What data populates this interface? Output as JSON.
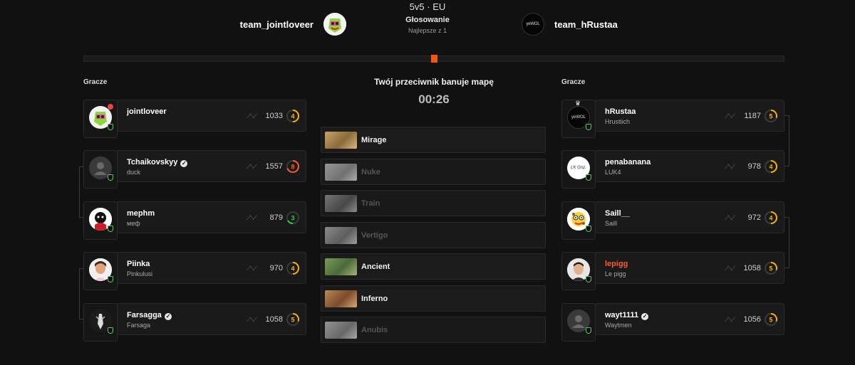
{
  "header": {
    "mode": "5v5 · EU",
    "status": "Głosowanie",
    "format": "Najlepsze z 1",
    "team_left": "team_jointloveer",
    "team_right": "team_hRustaa",
    "team_right_logo_text": "yeWOL",
    "vote_progress_pct": 50
  },
  "left": {
    "label": "Gracze",
    "players": [
      {
        "name": "jointloveer",
        "sub": "",
        "elo": "1033",
        "level": "4",
        "level_color": "#f5b400",
        "verified": false
      },
      {
        "name": "Tchaikovskyy",
        "sub": "duck",
        "elo": "1557",
        "level": "8",
        "level_color": "#ff5a2a",
        "verified": true
      },
      {
        "name": "mephm",
        "sub": "меф",
        "elo": "879",
        "level": "3",
        "level_color": "#2ecc40",
        "verified": false
      },
      {
        "name": "Piinka",
        "sub": "Pinkulusi",
        "elo": "970",
        "level": "4",
        "level_color": "#f5b400",
        "verified": false
      },
      {
        "name": "Farsagga",
        "sub": "Farsaga",
        "elo": "1058",
        "level": "5",
        "level_color": "#f5b400",
        "verified": true
      }
    ]
  },
  "right": {
    "label": "Gracze",
    "players": [
      {
        "name": "hRustaa",
        "sub": "Hrustiich",
        "elo": "1187",
        "level": "5",
        "level_color": "#f5b400",
        "verified": false,
        "avatar_text": "yeWOL"
      },
      {
        "name": "penabanana",
        "sub": "LUK4",
        "elo": "978",
        "level": "4",
        "level_color": "#f5b400",
        "verified": false,
        "avatar_text": "LK Gnz."
      },
      {
        "name": "Saill__",
        "sub": "Saill",
        "elo": "972",
        "level": "4",
        "level_color": "#f5b400",
        "verified": false
      },
      {
        "name": "lepigg",
        "sub": "Le pigg",
        "elo": "1058",
        "level": "5",
        "level_color": "#f5b400",
        "verified": false,
        "highlight": true
      },
      {
        "name": "wayt1111",
        "sub": "Waytmen",
        "elo": "1056",
        "level": "5",
        "level_color": "#f5b400",
        "verified": true
      }
    ]
  },
  "center": {
    "title": "Twój przeciwnik banuje mapę",
    "timer": "00:26",
    "maps": [
      {
        "name": "Mirage",
        "banned": false
      },
      {
        "name": "Nuke",
        "banned": true
      },
      {
        "name": "Train",
        "banned": true
      },
      {
        "name": "Vertigo",
        "banned": true
      },
      {
        "name": "Ancient",
        "banned": false
      },
      {
        "name": "Inferno",
        "banned": false
      },
      {
        "name": "Anubis",
        "banned": true
      }
    ]
  },
  "icons": {
    "trend": "trend-icon",
    "verified": "verified-icon",
    "shield": "shield-icon",
    "leader": "crown-icon"
  }
}
